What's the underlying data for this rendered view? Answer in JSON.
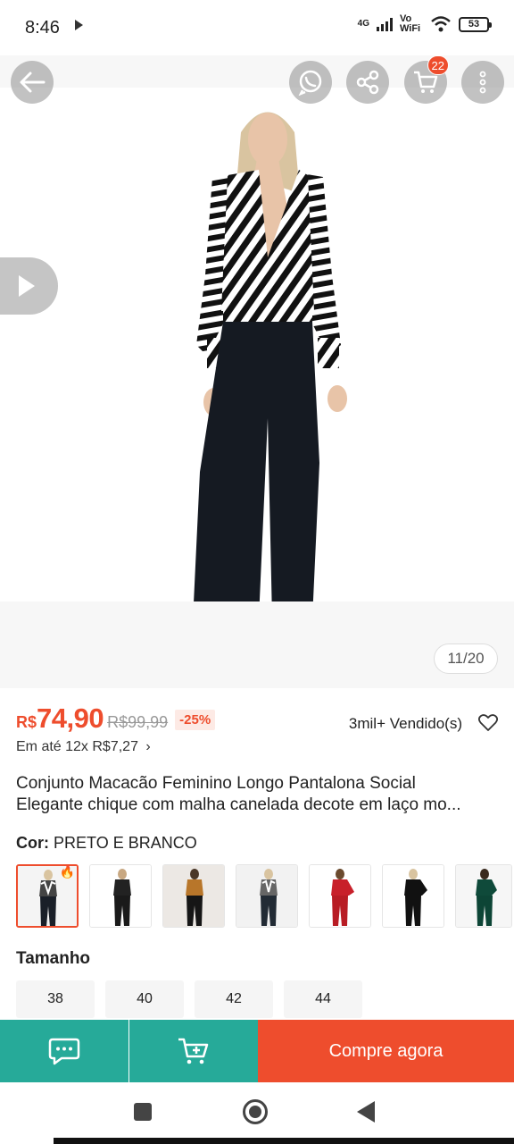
{
  "status_bar": {
    "time": "8:46",
    "network": "4G",
    "vowifi": "Vo WiFi",
    "battery": "53"
  },
  "image": {
    "counter": "11/20",
    "cart_count": "22",
    "icons": [
      "back-arrow-icon",
      "whatsapp-icon",
      "share-icon",
      "cart-icon",
      "more-vertical-icon",
      "play-icon"
    ]
  },
  "product": {
    "currency": "R$",
    "price": "74,90",
    "old_price": "R$99,99",
    "discount": "-25%",
    "sold": "3mil+ Vendido(s)",
    "installments": "Em até 12x R$7,27",
    "title_line1": "Conjunto Macacão Feminino Longo Pantalona Social",
    "title_line2": "Elegante chique com malha canelada decote em laço mo..."
  },
  "color": {
    "label": "Cor:",
    "value": "PRETO E BRANCO"
  },
  "size": {
    "label": "Tamanho",
    "options": [
      "38",
      "40",
      "42",
      "44"
    ]
  },
  "bottom_bar": {
    "buy_label": "Compre agora"
  },
  "colors": {
    "accent": "#ee4d2d",
    "teal": "#26aa99"
  }
}
